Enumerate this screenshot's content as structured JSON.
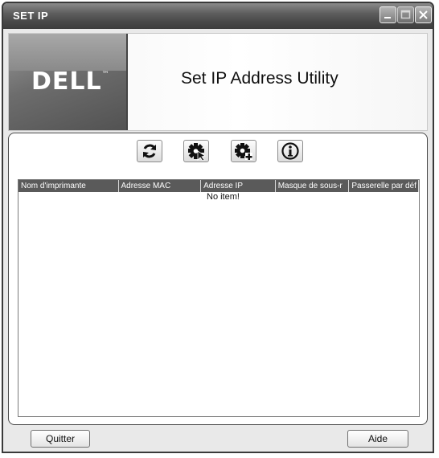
{
  "window": {
    "title": "SET IP"
  },
  "header": {
    "logo": "DELL",
    "logo_tm": "™",
    "title": "Set IP Address Utility"
  },
  "toolbar": {
    "icons": [
      "refresh-icon",
      "config-icon",
      "add-config-icon",
      "info-icon"
    ]
  },
  "list": {
    "columns": [
      "Nom d'imprimante",
      "Adresse MAC",
      "Adresse IP",
      "Masque de sous-r",
      "Passerelle par déf"
    ],
    "empty_message": "No item!"
  },
  "footer": {
    "quit_label": "Quitter",
    "help_label": "Aide"
  }
}
